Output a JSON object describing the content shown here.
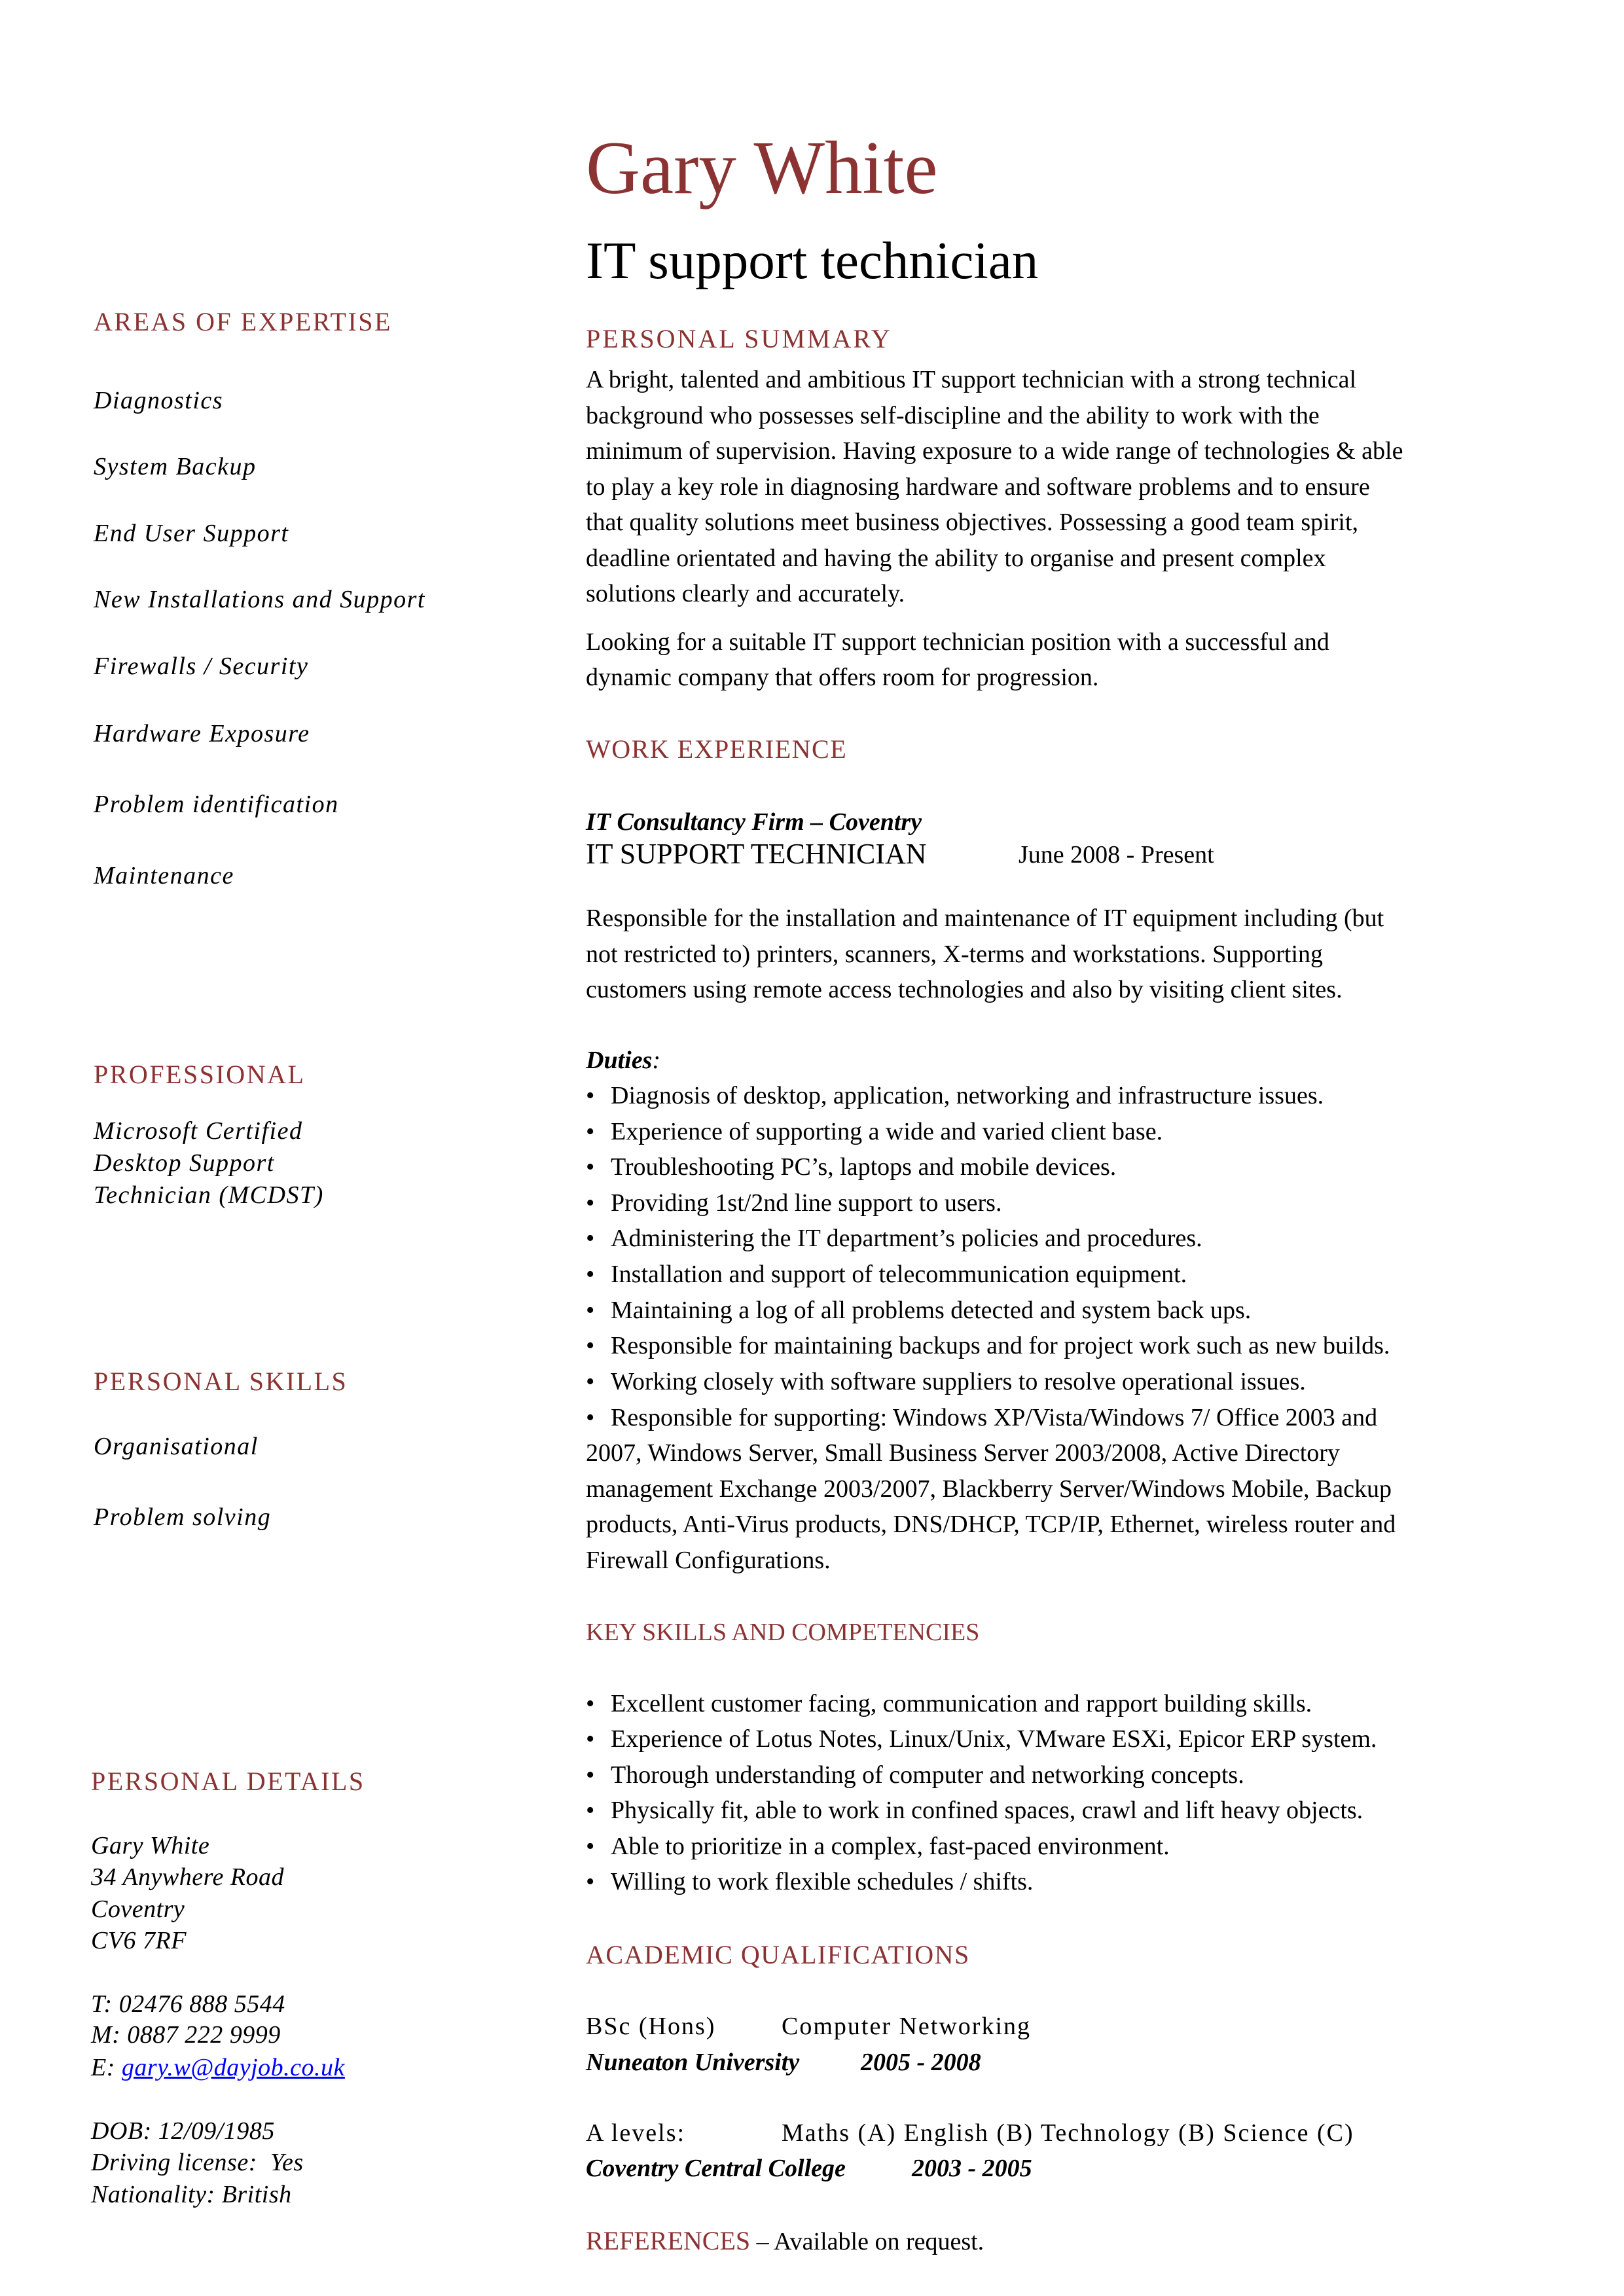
{
  "header": {
    "name": "Gary White",
    "job_title": "IT support technician"
  },
  "colors": {
    "accent": "#8b3333",
    "link": "#0000ff",
    "text": "#000000"
  },
  "sidebar": {
    "areas_of_expertise": {
      "heading": "AREAS OF EXPERTISE",
      "items": [
        "Diagnostics",
        "System Backup",
        "End User Support",
        "New Installations and Support",
        "Firewalls / Security",
        "Hardware Exposure",
        "Problem identification",
        "Maintenance"
      ]
    },
    "professional": {
      "heading": "PROFESSIONAL",
      "lines": [
        "Microsoft Certified",
        "Desktop Support",
        "Technician (MCDST)"
      ]
    },
    "personal_skills": {
      "heading": "PERSONAL SKILLS",
      "items": [
        "Organisational",
        "Problem solving"
      ]
    },
    "personal_details": {
      "heading": "PERSONAL DETAILS",
      "name": "Gary White",
      "address": [
        "34 Anywhere Road",
        "Coventry",
        "CV6 7RF"
      ],
      "phone": "T: 02476 888 5544",
      "mobile": "M: 0887 222 9999",
      "email_label": "E: ",
      "email": "gary.w@dayjob.co.uk",
      "dob": "DOB: 12/09/1985",
      "driving_license": "Driving license:  Yes",
      "nationality": "Nationality: British"
    }
  },
  "main": {
    "personal_summary": {
      "heading": "PERSONAL SUMMARY",
      "paragraph1_lines": [
        "A bright, talented and ambitious IT support technician with a strong technical",
        "background who possesses self-discipline and the ability to work with the",
        "minimum of supervision. Having exposure to a wide range of technologies & able",
        "to play a key role in diagnosing hardware and software problems and to ensure",
        "that quality solutions meet business objectives. Possessing a good team spirit,",
        "deadline orientated and having the ability to organise and present complex",
        "solutions clearly and accurately."
      ],
      "paragraph2_lines": [
        "Looking for a suitable IT support technician position with a successful and",
        "dynamic company that offers room for progression."
      ]
    },
    "work_experience": {
      "heading": "WORK EXPERIENCE",
      "company": "IT Consultancy Firm – Coventry",
      "position": "IT SUPPORT TECHNICIAN",
      "dates": "June 2008 - Present",
      "description_lines": [
        "Responsible for the installation and maintenance of IT equipment including (but",
        "not restricted to) printers, scanners, X-terms and workstations. Supporting",
        "customers using remote access technologies and also by visiting client sites."
      ],
      "duties_label": "Duties",
      "duties_colon": ":",
      "duties": [
        "Diagnosis of desktop, application, networking and infrastructure issues.",
        "Experience of supporting a wide and varied client base.",
        "Troubleshooting PC’s, laptops and mobile devices.",
        "Providing 1st/2nd line support to users.",
        "Administering the IT department’s policies and procedures.",
        "Installation and support of telecommunication equipment.",
        "Maintaining a log of all problems detected and system back ups.",
        "Responsible for maintaining backups and for project work such as new builds.",
        "Working closely with software suppliers to resolve operational issues."
      ],
      "last_duty_lines": [
        "Responsible for supporting: Windows XP/Vista/Windows 7/ Office 2003 and",
        "2007, Windows Server, Small Business Server 2003/2008, Active Directory",
        "management Exchange 2003/2007, Blackberry Server/Windows Mobile, Backup",
        "products, Anti-Virus products, DNS/DHCP, TCP/IP, Ethernet, wireless router and",
        "Firewall Configurations."
      ]
    },
    "key_skills": {
      "heading": "KEY SKILLS AND COMPETENCIES",
      "items": [
        "Excellent customer facing, communication and rapport building skills.",
        "Experience of Lotus Notes, Linux/Unix, VMware ESXi, Epicor ERP system.",
        "Thorough understanding of computer and networking concepts.",
        "Physically fit, able to work in confined spaces, crawl and lift heavy objects.",
        "Able to prioritize in a complex, fast-paced environment.",
        "Willing to work flexible schedules / shifts."
      ]
    },
    "academic": {
      "heading": "ACADEMIC QUALIFICATIONS",
      "degree": {
        "level": "BSc (Hons)",
        "subject": "Computer Networking",
        "institution": "Nuneaton University",
        "years": "2005 - 2008"
      },
      "a_levels": {
        "level": "A levels:",
        "subjects": "Maths (A) English (B) Technology (B) Science (C)",
        "institution": "Coventry Central College",
        "years": "2003 - 2005"
      }
    },
    "references": {
      "heading": "REFERENCES",
      "text": " – Available on request."
    }
  }
}
